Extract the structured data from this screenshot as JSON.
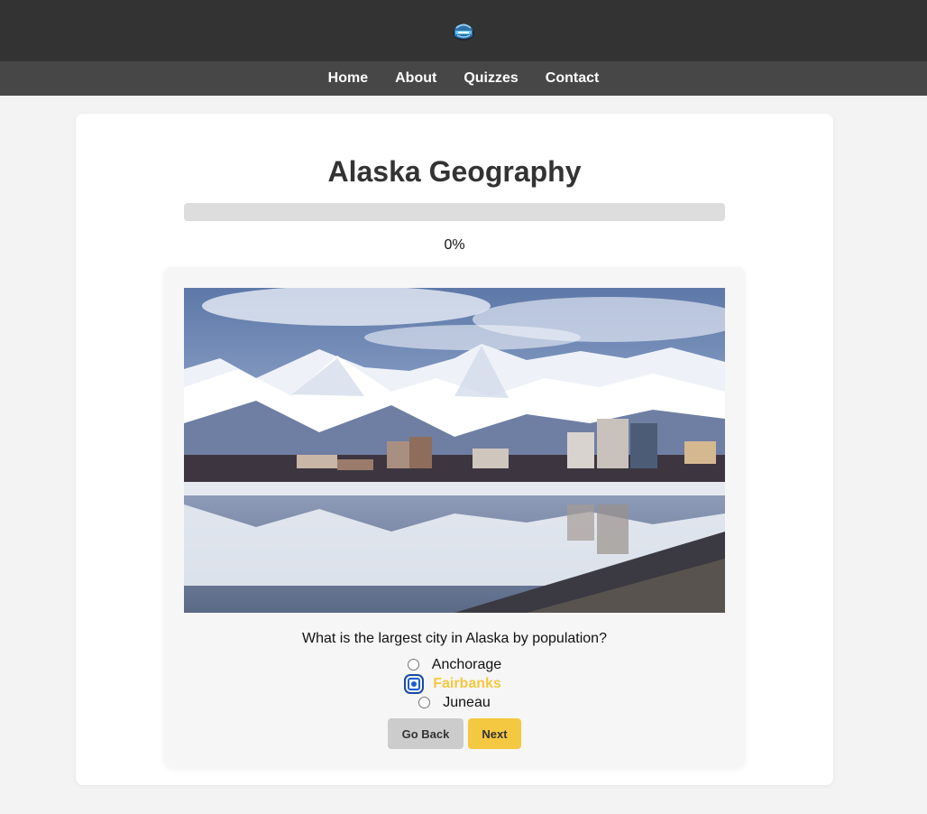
{
  "nav": {
    "items": [
      {
        "label": "Home"
      },
      {
        "label": "About"
      },
      {
        "label": "Quizzes"
      },
      {
        "label": "Contact"
      }
    ]
  },
  "quiz": {
    "title": "Alaska Geography",
    "progress_text": "0%",
    "progress_fraction": 0,
    "question": "What is the largest city in Alaska by population?",
    "options": [
      {
        "label": "Anchorage",
        "selected": false
      },
      {
        "label": "Fairbanks",
        "selected": true
      },
      {
        "label": "Juneau",
        "selected": false
      }
    ],
    "back_label": "Go Back",
    "next_label": "Next"
  },
  "colors": {
    "accent": "#f5c842",
    "topbar": "#333333",
    "navbar": "#474747",
    "radio_selected": "#1a5fd0"
  },
  "icons": {
    "logo": "stadium-logo-icon"
  }
}
